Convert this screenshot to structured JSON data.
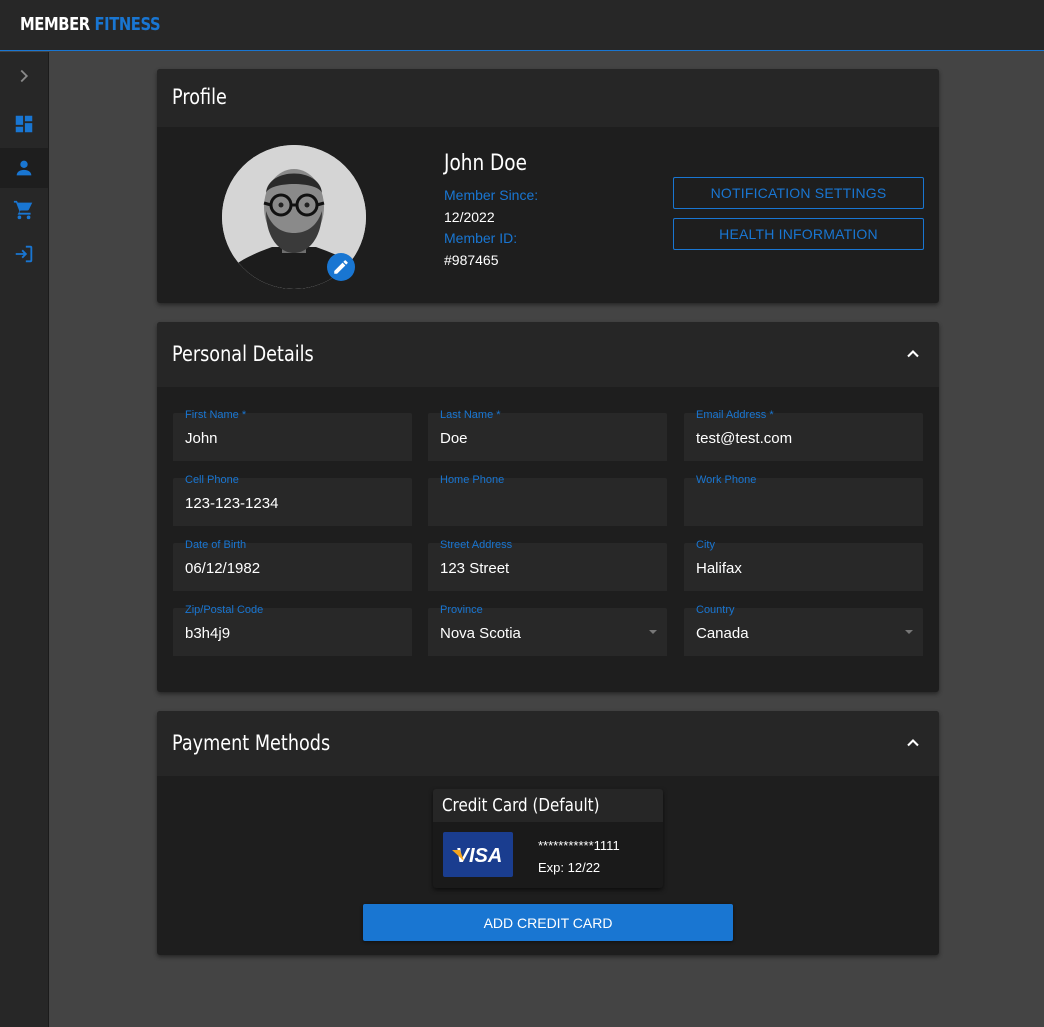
{
  "brand": {
    "part1": "MEMBER",
    "part2": "FITNESS"
  },
  "colors": {
    "accent": "#1976d2",
    "background": "#444444",
    "card": "#1e1e1e",
    "card_header": "#262626"
  },
  "sidebar": {
    "items": [
      {
        "icon": "chevron-right-icon",
        "active": false
      },
      {
        "icon": "dashboard-icon",
        "active": false
      },
      {
        "icon": "person-icon",
        "active": true
      },
      {
        "icon": "shopping-cart-icon",
        "active": false
      },
      {
        "icon": "logout-icon",
        "active": false
      }
    ]
  },
  "profile": {
    "title": "Profile",
    "name": "John Doe",
    "member_since_label": "Member Since:",
    "member_since": "12/2022",
    "member_id_label": "Member ID:",
    "member_id": "#987465",
    "notification_button": "NOTIFICATION SETTINGS",
    "health_button": "HEALTH INFORMATION"
  },
  "personal": {
    "title": "Personal Details",
    "fields": {
      "first_name": {
        "label": "First Name *",
        "value": "John"
      },
      "last_name": {
        "label": "Last Name *",
        "value": "Doe"
      },
      "email": {
        "label": "Email Address *",
        "value": "test@test.com"
      },
      "cell_phone": {
        "label": "Cell Phone",
        "value": "123-123-1234"
      },
      "home_phone": {
        "label": "Home Phone",
        "value": ""
      },
      "work_phone": {
        "label": "Work Phone",
        "value": ""
      },
      "dob": {
        "label": "Date of Birth",
        "value": "06/12/1982"
      },
      "street": {
        "label": "Street Address",
        "value": "123 Street"
      },
      "city": {
        "label": "City",
        "value": "Halifax"
      },
      "zip": {
        "label": "Zip/Postal Code",
        "value": "b3h4j9"
      },
      "province": {
        "label": "Province",
        "value": "Nova Scotia"
      },
      "country": {
        "label": "Country",
        "value": "Canada"
      }
    }
  },
  "payment": {
    "title": "Payment Methods",
    "card": {
      "title": "Credit Card (Default)",
      "brand": "VISA",
      "number": "***********1111",
      "expiry": "Exp: 12/22"
    },
    "add_button": "ADD CREDIT CARD"
  }
}
